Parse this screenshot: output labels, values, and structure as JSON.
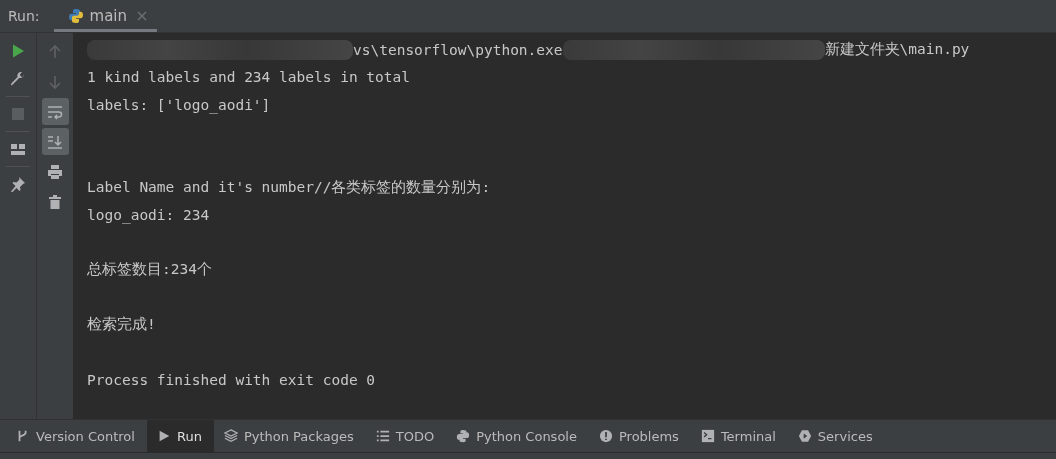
{
  "run_label": "Run:",
  "tabs": [
    {
      "label": "main",
      "selected": true
    }
  ],
  "left_tools": [
    {
      "kind": "run"
    },
    {
      "kind": "wrench"
    },
    {
      "kind": "stop"
    },
    {
      "kind": "layout"
    },
    {
      "kind": "pin"
    }
  ],
  "console_tools": [
    {
      "kind": "up",
      "on": false
    },
    {
      "kind": "down",
      "on": false
    },
    {
      "kind": "wrap",
      "on": true
    },
    {
      "kind": "scroll-end",
      "on": true
    },
    {
      "kind": "print",
      "on": false
    },
    {
      "kind": "trash",
      "on": false
    }
  ],
  "console": [
    {
      "kind": "command",
      "parts": [
        "vs\\tensorflow\\python.exe",
        "新建文件夹\\main.py"
      ]
    },
    {
      "kind": "text",
      "text": "1 kind labels and 234 labels in total"
    },
    {
      "kind": "text",
      "text": "labels: ['logo_aodi']"
    },
    {
      "kind": "blank"
    },
    {
      "kind": "blank"
    },
    {
      "kind": "text",
      "text": "Label Name and it's number//各类标签的数量分别为:"
    },
    {
      "kind": "text",
      "text": "logo_aodi: 234"
    },
    {
      "kind": "blank"
    },
    {
      "kind": "text",
      "text": "总标签数目:234个"
    },
    {
      "kind": "blank"
    },
    {
      "kind": "text",
      "text": "检索完成!"
    },
    {
      "kind": "blank"
    },
    {
      "kind": "text",
      "text": "Process finished with exit code 0"
    }
  ],
  "bottom_tabs": [
    {
      "label": "Version Control",
      "kind": "vcs",
      "selected": false
    },
    {
      "label": "Run",
      "kind": "run",
      "selected": true
    },
    {
      "label": "Python Packages",
      "kind": "layers",
      "selected": false
    },
    {
      "label": "TODO",
      "kind": "list",
      "selected": false
    },
    {
      "label": "Python Console",
      "kind": "python",
      "selected": false
    },
    {
      "label": "Problems",
      "kind": "alert",
      "selected": false
    },
    {
      "label": "Terminal",
      "kind": "terminal",
      "selected": false
    },
    {
      "label": "Services",
      "kind": "services",
      "selected": false
    }
  ]
}
